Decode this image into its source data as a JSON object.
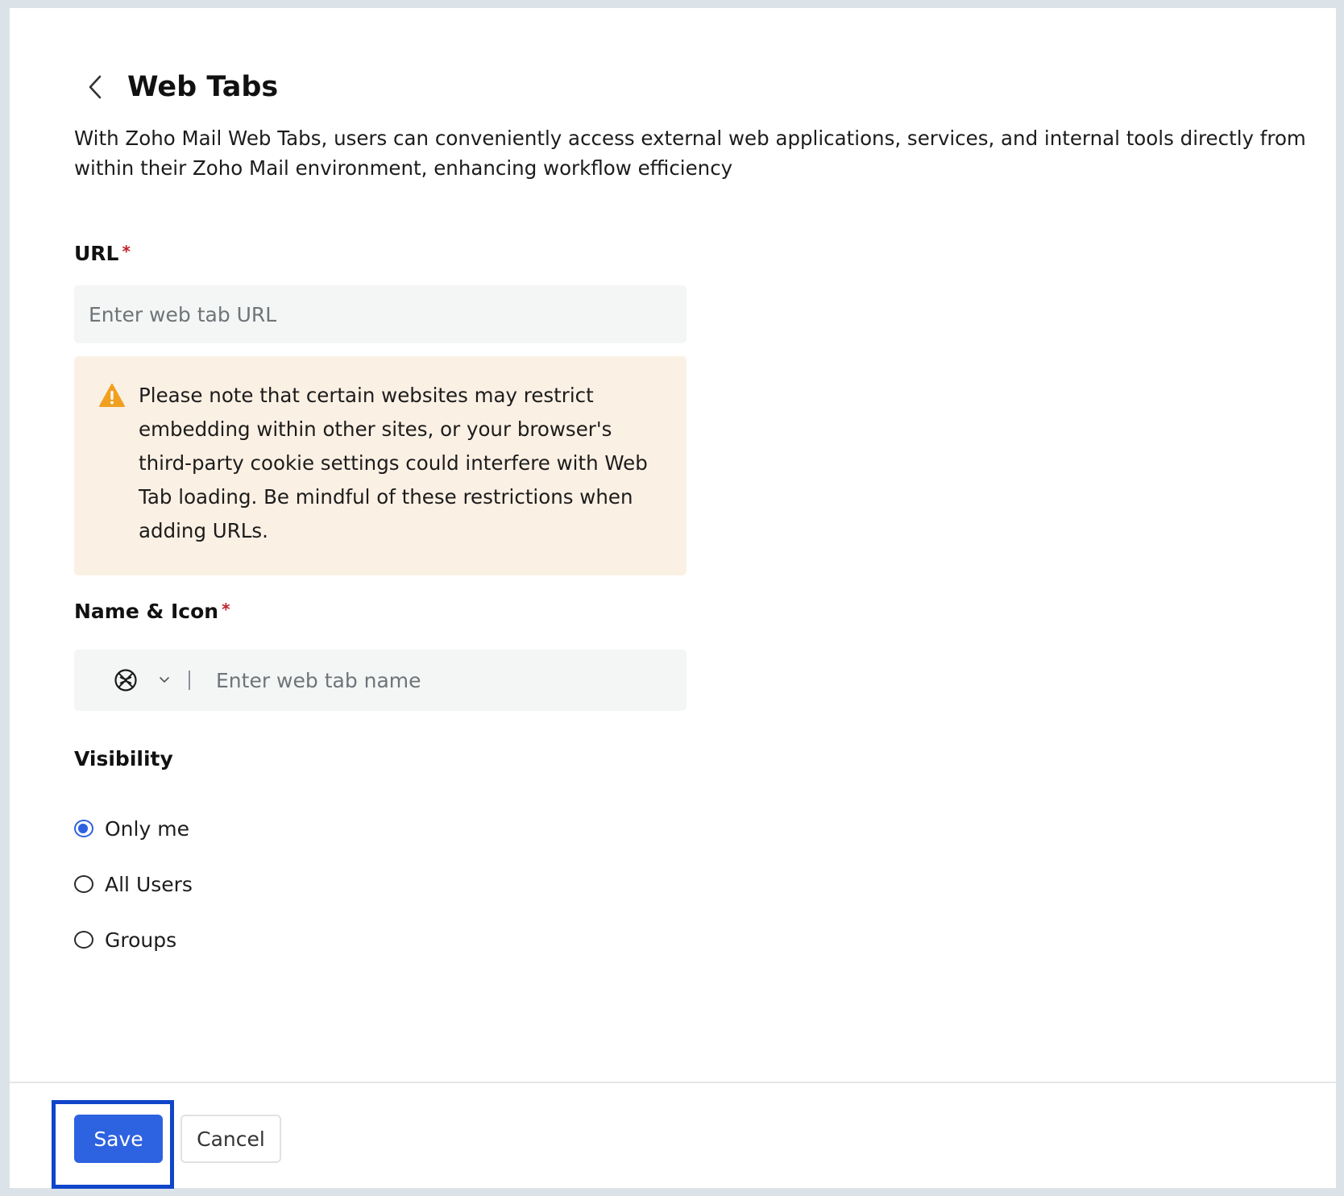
{
  "header": {
    "back_icon": "chevron-left-icon",
    "title": "Web Tabs"
  },
  "description": "With Zoho Mail Web Tabs, users can conveniently access external web applications, services, and internal tools directly from within their Zoho Mail environment, enhancing workflow efficiency",
  "url_field": {
    "label": "URL",
    "required_mark": "*",
    "placeholder": "Enter web tab URL",
    "value": ""
  },
  "warning": {
    "icon": "warning-triangle-icon",
    "text": "Please note that certain websites may restrict embedding within other sites, or your browser's third-party cookie settings could interfere with Web Tab loading. Be mindful of these restrictions when adding URLs."
  },
  "name_field": {
    "label": "Name & Icon",
    "required_mark": "*",
    "icon": "globe-icon",
    "placeholder": "Enter web tab name",
    "value": ""
  },
  "visibility": {
    "label": "Visibility",
    "options": [
      {
        "label": "Only me",
        "checked": true
      },
      {
        "label": "All Users",
        "checked": false
      },
      {
        "label": "Groups",
        "checked": false
      }
    ]
  },
  "footer": {
    "save_label": "Save",
    "cancel_label": "Cancel"
  },
  "colors": {
    "primary": "#2d62e0",
    "highlight": "#0f45c9",
    "warning_bg": "#fbf0e4",
    "warning_icon": "#f0a020",
    "required": "#c0212b"
  }
}
